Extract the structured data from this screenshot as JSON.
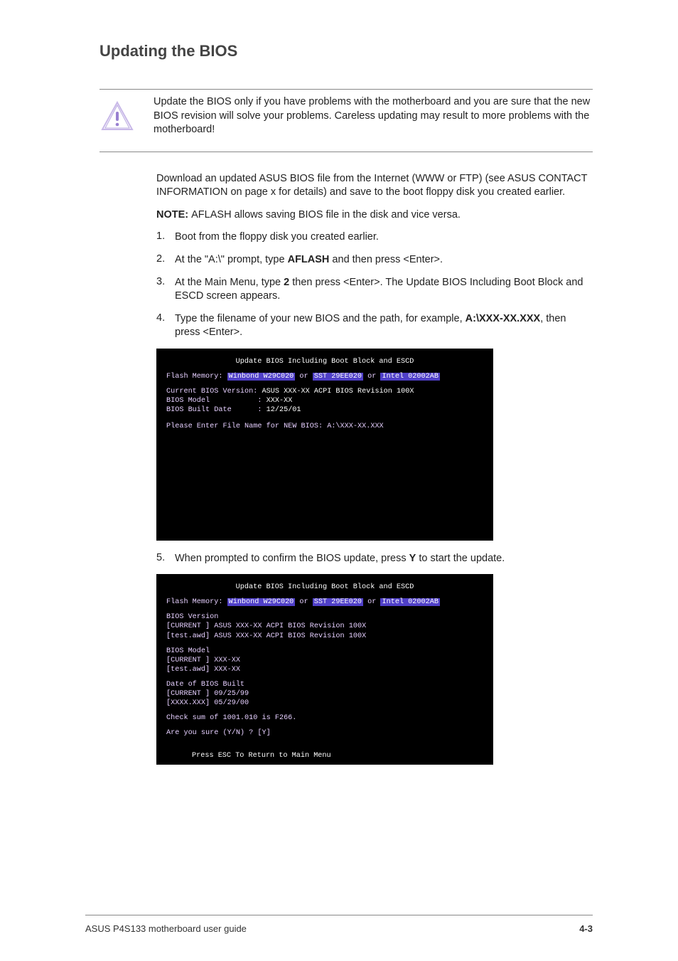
{
  "heading": "Updating the BIOS",
  "caution": "Update the BIOS only if you have problems with the motherboard and you are sure that the new BIOS revision will solve your problems. Careless updating may result to more problems with the motherboard!",
  "intro1": "Download an updated ASUS BIOS file from the Internet (WWW or FTP) (see ASUS CONTACT INFORMATION on page x for details) and save to the boot floppy disk you created earlier.",
  "intro2_prefix": "NOTE: ",
  "intro2": "AFLASH allows saving BIOS file in the disk and vice versa.",
  "steps": {
    "s1_num": "1.",
    "s1_text": "Boot from the floppy disk you created earlier.",
    "s2_num": "2.",
    "s2_pre": "At the \"A:\\\" prompt, type ",
    "s2_bold": "AFLASH",
    "s2_post": " and then press <Enter>.",
    "s3_num": "3.",
    "s3_pre": "At the Main Menu, type ",
    "s3_bold": "2",
    "s3_post": " then press <Enter>. The Update BIOS Including Boot Block and ESCD screen appears.",
    "s4_num": "4.",
    "s4_pre": "Type the filename of your new BIOS and the path, for example, ",
    "s4_bold": "A:\\XXX-XX.XXX",
    "s4_post": ", then press <Enter>."
  },
  "screenshot1": {
    "title": "Update BIOS Including Boot Block and ESCD",
    "flashmem_label": "Flash Memory: ",
    "hl1": "Winbond W29C020",
    "or": " or ",
    "hl2": "SST 29EE020",
    "hl3": "Intel 02002AB",
    "line_cver_lbl": "Current BIOS Version: ",
    "line_cver_val": "ASUS XXX-XX ACPI BIOS Revision 100X",
    "line_model_lbl": "BIOS Model           : ",
    "line_model_val": "XXX-XX",
    "line_date_lbl": "BIOS Built Date      : ",
    "line_date_val": "12/25/01",
    "prompt": "Please Enter File Name for NEW BIOS: A:\\XXX-XX.XXX"
  },
  "between_screens_num": "5.",
  "between_screens_pre": "When prompted to confirm the BIOS update, press ",
  "between_screens_bold": "Y",
  "between_screens_post": " to start the update.",
  "screenshot2": {
    "title": "Update BIOS Including Boot Block and ESCD",
    "flashmem_label": "Flash Memory: ",
    "hl1": "Winbond W29C020",
    "or": " or ",
    "hl2": "SST 29EE020",
    "hl3": "Intel 02002AB",
    "blk_ver_hdr": "BIOS Version",
    "blk_ver_l1": "[CURRENT ] ASUS XXX-XX ACPI BIOS Revision 100X",
    "blk_ver_l2": "[test.awd] ASUS XXX-XX ACPI BIOS Revision 100X",
    "blk_model_hdr": "BIOS Model",
    "blk_model_l1": "[CURRENT ] XXX-XX",
    "blk_model_l2": "[test.awd] XXX-XX",
    "blk_date_hdr": "Date of BIOS Built",
    "blk_date_l1": "[CURRENT ] 09/25/99",
    "blk_date_l2": "[XXXX.XXX] 05/29/00",
    "chk": "Check sum of 1001.010 is F266.",
    "sure": "Are you sure (Y/N) ? [Y]",
    "bottom_pre": "Press ",
    "bottom_esc": "ESC",
    "bottom_post": " To Return to Main Menu"
  },
  "footer": {
    "left": "ASUS P4S133 motherboard user guide",
    "right": "4-3"
  }
}
